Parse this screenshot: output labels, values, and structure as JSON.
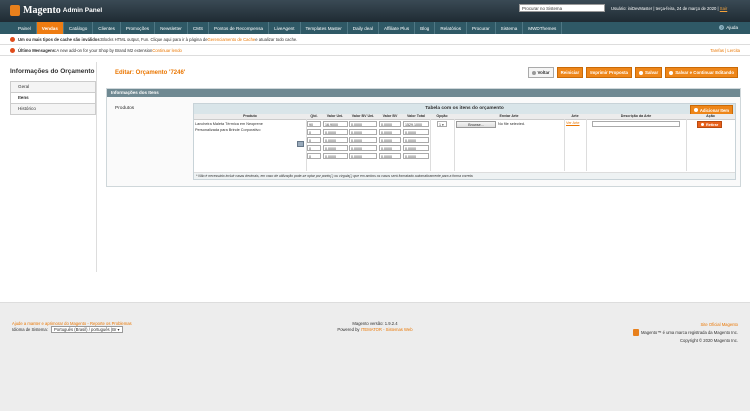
{
  "header": {
    "logo_main": "Magento",
    "logo_sub": "Admin Panel",
    "search_value": "Procurar no Sistema",
    "user_text": "Usuário: iniDevMaster  |  terça-feira, 24 de março de 2020  |",
    "logout": "Sair"
  },
  "nav": {
    "items": [
      "Painel",
      "Vendas",
      "Catálogo",
      "Clientes",
      "Promoções",
      "Newsletter",
      "CMS",
      "Pontos de Recompensa",
      "LiveAgent",
      "Templates Master",
      "Daily deal",
      "Affiliate Plus",
      "Blog",
      "Relatórios",
      "Procurar",
      "Sistema",
      "MWDThemes"
    ],
    "help": "Ajuda"
  },
  "messages": {
    "m1_bold": "Um ou mais tipos de cache são inválidos:",
    "m1_text": " Blocks HTML output, Fun. Clique aqui para ir à página de ",
    "m1_link": "Gerenciamento de Cache",
    "m1_tail": " e atualizar todo cache.",
    "m2_bold": "Último Mensagens:",
    "m2_text": " A new add-on for your Shop by Brand M2 extension ",
    "m2_link": "Continuar lendo",
    "m2_right": "Tarefas | Lercita"
  },
  "sidebar": {
    "title": "Informações do Orçamento",
    "tabs": [
      "Geral",
      "Itens",
      "Histórico"
    ]
  },
  "page": {
    "title": "Editar: Orçamento '7246'",
    "buttons": {
      "back": "Voltar",
      "reset": "Reiniciar",
      "print": "Imprimir Proposta",
      "save": "Salvar",
      "save_continue": "Salvar e Continuar Editando"
    }
  },
  "section": {
    "header": "Informações dos Itens",
    "products_label": "Produtos",
    "grid_title": "Tabela com os itens do orçamento",
    "add_item": "Adicionar Item",
    "columns": [
      "Produto",
      "Qtd.",
      "Valor Uni.",
      "Valor BV Uni.",
      "Valor BV",
      "Valor Total",
      "Opção",
      "Enviar Arte",
      "Arte",
      "Descrição da Arte",
      "Ação"
    ],
    "product_name": "Lancheira Maleta Térmica em Neoprene Personalizada para Brinde Corporativo",
    "rows": [
      {
        "qty": "90",
        "unit": "16.9000",
        "bv_unit": "0.0000",
        "bv": "0.0000",
        "total": "1529.1000"
      },
      {
        "qty": "0",
        "unit": "0.0000",
        "bv_unit": "0.0000",
        "bv": "0.0000",
        "total": "0.0000"
      },
      {
        "qty": "0",
        "unit": "0.0000",
        "bv_unit": "0.0000",
        "bv": "0.0000",
        "total": "0.0000"
      },
      {
        "qty": "0",
        "unit": "0.0000",
        "bv_unit": "0.0000",
        "bv": "0.0000",
        "total": "0.0000"
      },
      {
        "qty": "0",
        "unit": "0.0000",
        "bv_unit": "0.0000",
        "bv": "0.0000",
        "total": "0.0000"
      }
    ],
    "option_value": "1",
    "browse": "Browse...",
    "no_file": "No file selected.",
    "art_link": "Ver Arte",
    "remove": "Retirar",
    "note": "* Não é necessário incluir casas decimais, em caso de utilização pode-se optar por ponto(.) ou vírgula(,) que em ambos os casos será formatado automaticamente para a forma correta."
  },
  "footer": {
    "help_link": "Ajude a manter e aprimorar do Magento - Reporte os Problemas",
    "locale_label": "Idioma de Sistema:",
    "locale_value": "Português (Brasil) / português (Br",
    "version": "Magento versão: 1.9.2.4",
    "powered": "Powered by",
    "powered_link": "ITEMATOR - Sistemas Web",
    "official": "Site Oficial Magento",
    "trademark": "Magento™ é uma marca registrada da Magento Inc.",
    "copyright": "Copyright © 2020 Magento Inc."
  }
}
